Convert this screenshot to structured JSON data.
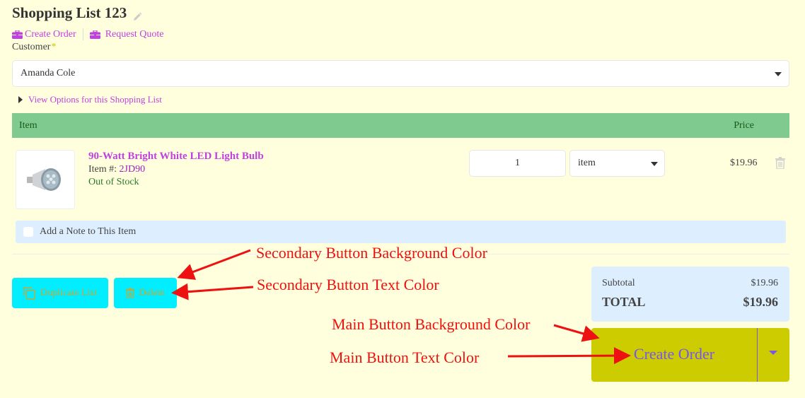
{
  "header": {
    "title": "Shopping List 123",
    "actions": [
      {
        "label": "Create Order",
        "icon": "briefcase-icon"
      },
      {
        "label": "Request Quote",
        "icon": "briefcase-icon"
      }
    ]
  },
  "customer": {
    "label": "Customer",
    "required_mark": "*",
    "selected": "Amanda Cole"
  },
  "view_options_label": "View Options for this Shopping List",
  "table": {
    "headers": {
      "item": "Item",
      "price": "Price"
    },
    "rows": [
      {
        "name": "90-Watt Bright White LED Light Bulb",
        "item_number_label": "Item #:",
        "item_number": "2JD90",
        "stock_status": "Out of Stock",
        "quantity": "1",
        "unit": "item",
        "price": "$19.96"
      }
    ],
    "note_label": "Add a Note to This Item"
  },
  "secondary_buttons": {
    "duplicate": "Duplicate List",
    "delete": "Delete"
  },
  "summary": {
    "subtotal_label": "Subtotal",
    "subtotal_value": "$19.96",
    "total_label": "TOTAL",
    "total_value": "$19.96"
  },
  "main_button": {
    "label": "Create Order"
  },
  "annotations": {
    "secondary_bg": "Secondary Button Background Color",
    "secondary_text": "Secondary Button Text Color",
    "main_bg": "Main Button Background Color",
    "main_text": "Main Button Text Color"
  },
  "colors": {
    "page_background": "#ffffdd",
    "link": "#c040e0",
    "table_header": "#7fca8e",
    "secondary_button_bg": "#00eeff",
    "secondary_button_text": "#c8a830",
    "main_button_bg": "#cccc00",
    "main_button_text": "#7755ee",
    "annotation": "#ee1111"
  }
}
